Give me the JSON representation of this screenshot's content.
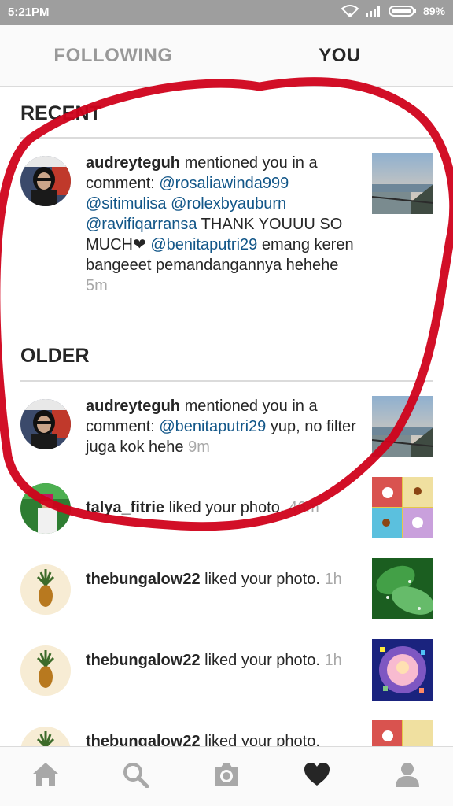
{
  "status_bar": {
    "time": "5:21PM",
    "battery": "89%"
  },
  "tabs": [
    {
      "label": "FOLLOWING"
    },
    {
      "label": "YOU"
    }
  ],
  "sections": {
    "recent": "RECENT",
    "older": "OLDER"
  },
  "notifications": [
    {
      "user": "audreyteguh",
      "text_1": " mentioned you in a comment: ",
      "mention_1": "@rosaliawinda999",
      "space_1": " ",
      "mention_2": "@sitimulisa",
      "space_2": " ",
      "mention_3": "@rolexbyauburn",
      "space_3": " ",
      "mention_4": "@ravifiqarransa",
      "text_2": " THANK YOUUU SO MUCH❤ ",
      "mention_5": "@benitaputri29",
      "text_3": " emang keren bangeeet pemandangannya hehehe ",
      "time": "5m"
    },
    {
      "user": "audreyteguh",
      "text_1": " mentioned you in a comment: ",
      "mention_1": "@benitaputri29",
      "text_2": " yup, no filter juga kok hehe ",
      "time": "9m"
    },
    {
      "user": "talya_fitrie",
      "text_1": " liked your photo. ",
      "time": "46m"
    },
    {
      "user": "thebungalow22",
      "text_1": " liked your photo. ",
      "time": "1h"
    },
    {
      "user": "thebungalow22",
      "text_1": " liked your photo. ",
      "time": "1h"
    },
    {
      "user": "thebungalow22",
      "text_1": " liked your photo."
    }
  ],
  "bottom_nav": [
    {
      "icon": "home-icon"
    },
    {
      "icon": "search-icon"
    },
    {
      "icon": "camera-icon"
    },
    {
      "icon": "heart-icon"
    },
    {
      "icon": "profile-icon"
    }
  ],
  "colors": {
    "mention": "#125688",
    "time": "#a8a8a8",
    "annotation": "#d0021b"
  }
}
